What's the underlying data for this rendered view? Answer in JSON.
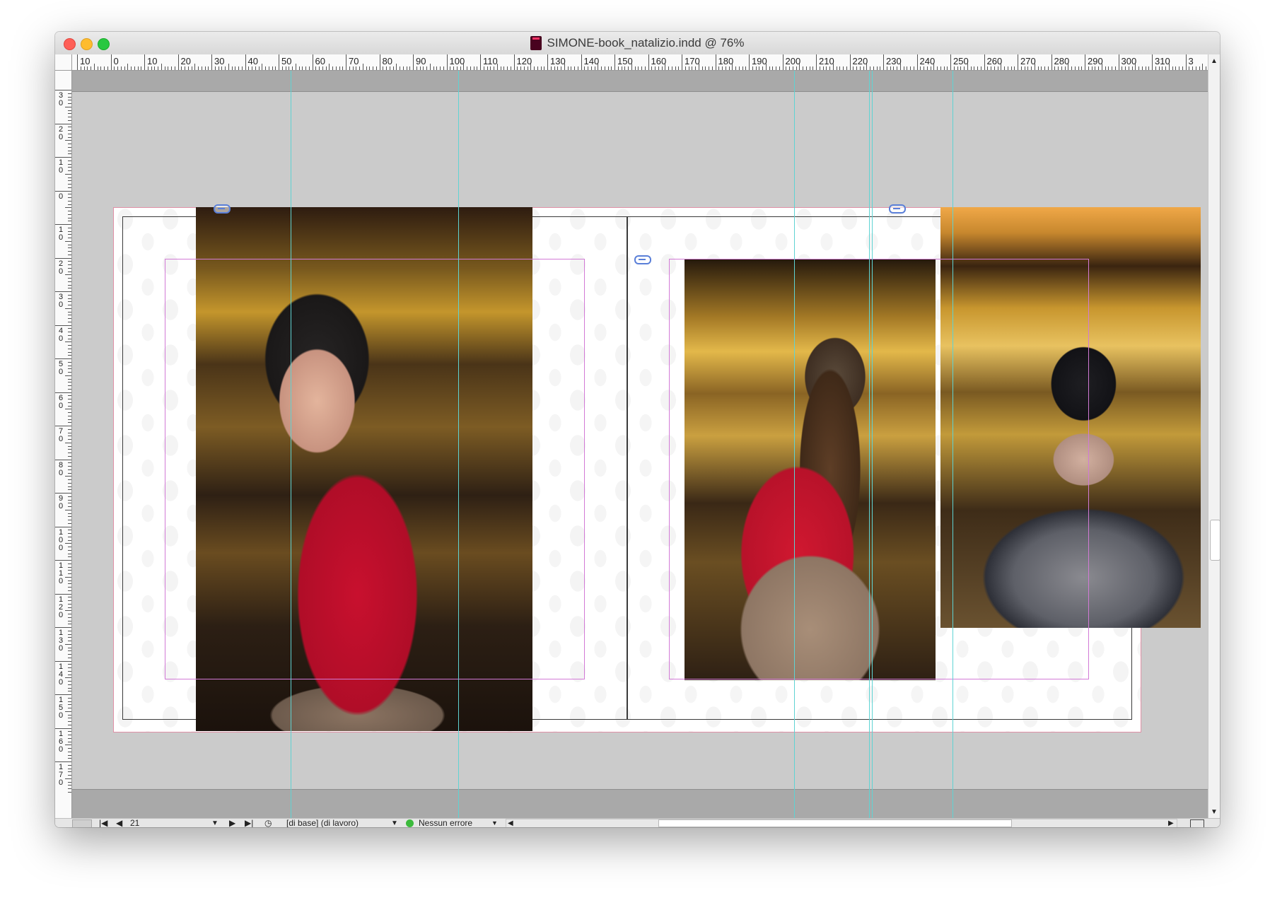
{
  "window": {
    "title": "SIMONE-book_natalizio.indd @ 76%",
    "traffic_lights": {
      "close": "#fe5f57",
      "minimize": "#febc2e",
      "zoom": "#28c840"
    }
  },
  "rulers": {
    "horizontal_labels": [
      "10",
      "0",
      "10",
      "20",
      "30",
      "40",
      "50",
      "60",
      "70",
      "80",
      "90",
      "100",
      "110",
      "120",
      "130",
      "140",
      "150",
      "160",
      "170",
      "180",
      "190",
      "200",
      "210",
      "220",
      "230",
      "240",
      "250",
      "260",
      "270",
      "280",
      "290",
      "300",
      "310",
      "3"
    ],
    "vertical_labels": [
      "30",
      "20",
      "10",
      "0",
      "10",
      "20",
      "30",
      "40",
      "50",
      "60",
      "70",
      "80",
      "90",
      "100",
      "110",
      "120",
      "130",
      "140",
      "150",
      "160",
      "170"
    ]
  },
  "canvas": {
    "guide_color": "#5fd3d3",
    "margin_color": "#d27ad6",
    "bleed_color": "#e090a6",
    "photos": [
      {
        "subject": "woman-in-red-coat-portrait"
      },
      {
        "subject": "woman-back-wavy-hair"
      },
      {
        "subject": "woman-back-fur-stole"
      }
    ]
  },
  "statusbar": {
    "page_number": "21",
    "master": "[di base] (di lavoro)",
    "preflight_status": "Nessun errore",
    "preflight_color": "#3cba3c"
  }
}
